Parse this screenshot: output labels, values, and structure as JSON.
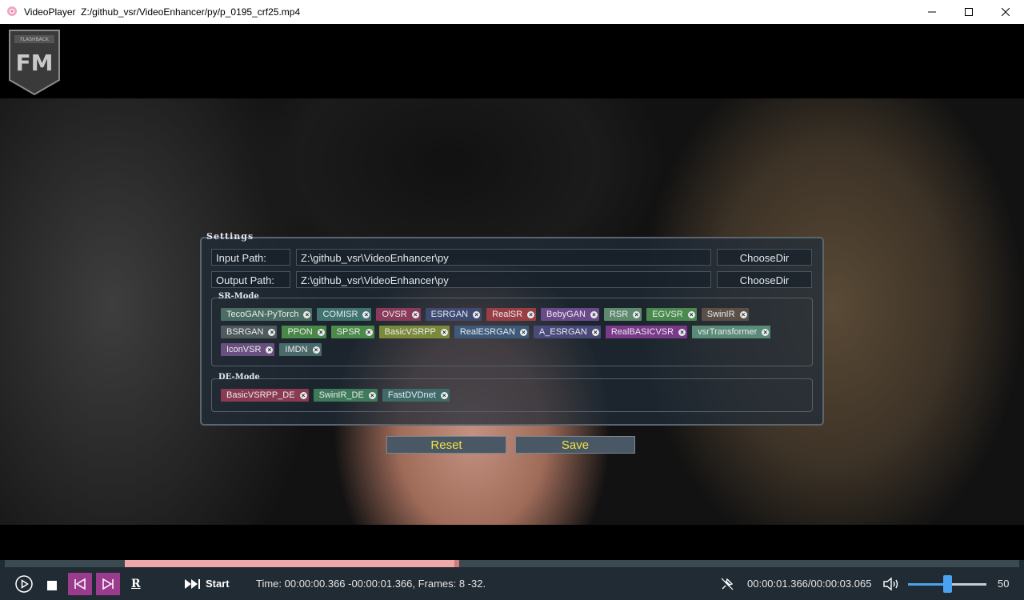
{
  "window": {
    "app_name": "VideoPlayer",
    "file_path": "Z:/github_vsr/VideoEnhancer/py/p_0195_crf25.mp4",
    "minimize_glyph": "—",
    "maximize_glyph": "☐",
    "close_glyph": "✕"
  },
  "settings": {
    "title": "Settings",
    "input_path_label": "Input Path:",
    "input_path_value": "Z:\\github_vsr\\VideoEnhancer\\py",
    "output_path_label": "Output Path:",
    "output_path_value": "Z:\\github_vsr\\VideoEnhancer\\py",
    "choose_dir_label": "ChooseDir",
    "sr_mode_title": "SR-Mode",
    "de_mode_title": "DE-Mode",
    "sr_tags": [
      {
        "label": "TecoGAN-PyTorch",
        "color": "#4a6e64"
      },
      {
        "label": "COMISR",
        "color": "#3f7470"
      },
      {
        "label": "OVSR",
        "color": "#8a3a5a"
      },
      {
        "label": "ESRGAN",
        "color": "#3e4a72"
      },
      {
        "label": "RealSR",
        "color": "#9a3e46"
      },
      {
        "label": "BebyGAN",
        "color": "#6a4a8a"
      },
      {
        "label": "RSR",
        "color": "#5e8a6e"
      },
      {
        "label": "EGVSR",
        "color": "#4a8a4e"
      },
      {
        "label": "SwinIR",
        "color": "#5a5048"
      },
      {
        "label": "BSRGAN",
        "color": "#4e5a5e"
      },
      {
        "label": "PPON",
        "color": "#4a8848"
      },
      {
        "label": "SPSR",
        "color": "#4a8a4a"
      },
      {
        "label": "BasicVSRPP",
        "color": "#7a8a3a"
      },
      {
        "label": "RealESRGAN",
        "color": "#3e5a7a"
      },
      {
        "label": "A_ESRGAN",
        "color": "#4a4a7a"
      },
      {
        "label": "RealBASICVSR",
        "color": "#7a3a8a"
      },
      {
        "label": "vsrTransformer",
        "color": "#5a8a78"
      },
      {
        "label": "IconVSR",
        "color": "#6a5080"
      },
      {
        "label": "IMDN",
        "color": "#4a6a6a"
      }
    ],
    "de_tags": [
      {
        "label": "BasicVSRPP_DE",
        "color": "#8a3a52"
      },
      {
        "label": "SwinIR_DE",
        "color": "#3e7a5a"
      },
      {
        "label": "FastDVDnet",
        "color": "#3e6a6a"
      }
    ],
    "reset_label": "Reset",
    "save_label": "Save"
  },
  "controls": {
    "progress_fraction": 0.448,
    "progress_start_fraction": 0.118,
    "start_label": "Start",
    "r_label": "R",
    "time_info": "Time: 00:00:00.366 -00:00:01.366, Frames: 8 -32.",
    "duration": "00:00:01.366/00:00:03.065",
    "volume": 50,
    "volume_label": "50"
  }
}
